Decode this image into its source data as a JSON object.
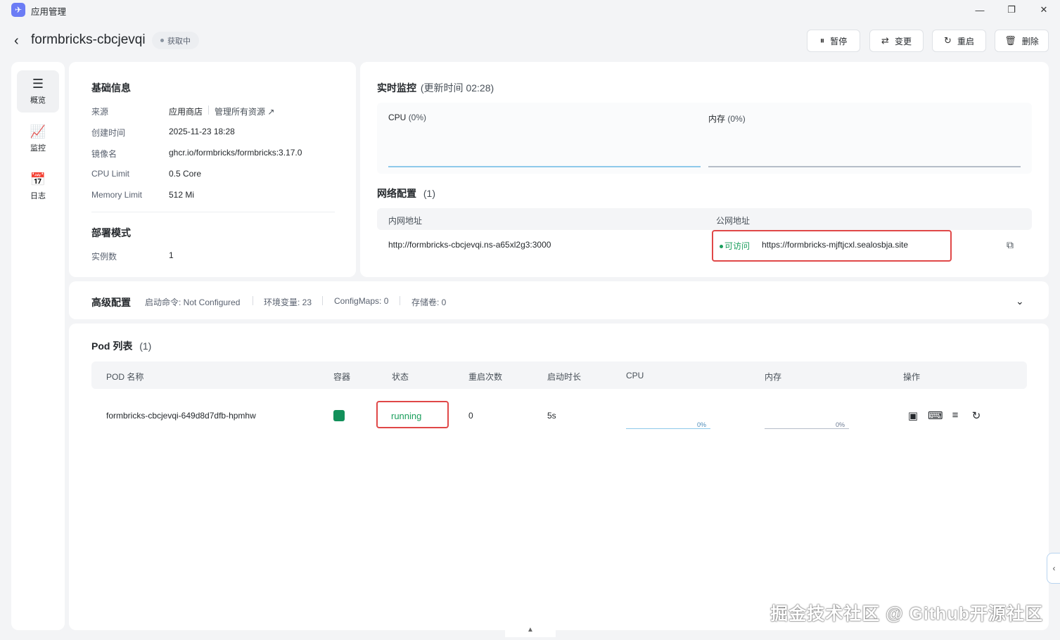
{
  "window": {
    "title": "应用管理",
    "controls": [
      "minimize-icon",
      "restore-icon",
      "close-icon"
    ]
  },
  "header": {
    "app_name": "formbricks-cbcjevqi",
    "status": "获取中",
    "buttons": {
      "pause": "暂停",
      "change": "变更",
      "restart": "重启",
      "delete": "删除"
    }
  },
  "sidebar": {
    "items": [
      {
        "label": "概览",
        "icon": "overview-icon",
        "active": true
      },
      {
        "label": "监控",
        "icon": "chart-icon",
        "active": false
      },
      {
        "label": "日志",
        "icon": "log-icon",
        "active": false
      }
    ]
  },
  "basic_info": {
    "title": "基础信息",
    "source_label": "来源",
    "source_value": "应用商店",
    "source_link": "管理所有资源",
    "created_label": "创建时间",
    "created_value": "2025-11-23 18:28",
    "image_label": "镜像名",
    "image_value": "ghcr.io/formbricks/formbricks:3.17.0",
    "cpu_label": "CPU Limit",
    "cpu_value": "0.5 Core",
    "memory_label": "Memory Limit",
    "memory_value": "512 Mi",
    "deploy_title": "部署模式",
    "instances_label": "实例数",
    "instances_value": "1"
  },
  "monitor": {
    "title": "实时监控",
    "update": "(更新时间  02:28)",
    "cpu_label": "CPU",
    "cpu_value": "(0%)",
    "mem_label": "内存",
    "mem_value": "(0%)"
  },
  "network": {
    "title": "网络配置",
    "count": "(1)",
    "col_internal": "内网地址",
    "col_public": "公网地址",
    "internal_address": "http://formbricks-cbcjevqi.ns-a65xl2g3:3000",
    "public_status": "可访问",
    "public_address": "https://formbricks-mjftjcxl.sealosbja.site"
  },
  "advanced": {
    "title": "高级配置",
    "start_cmd": "启动命令: Not Configured",
    "env": "环境变量: 23",
    "configmaps": "ConfigMaps: 0",
    "storage": "存储卷: 0"
  },
  "pods": {
    "title": "Pod 列表",
    "count": "(1)",
    "columns": [
      "POD 名称",
      "容器",
      "状态",
      "重启次数",
      "启动时长",
      "CPU",
      "内存",
      "操作"
    ],
    "rows": [
      {
        "name": "formbricks-cbcjevqi-649d8d7dfb-hpmhw",
        "status": "running",
        "restarts": "0",
        "uptime": "5s",
        "cpu": "0%",
        "memory": "0%",
        "cpu_fraction": 0,
        "memory_fraction": 0
      }
    ],
    "actions": [
      "calendar-icon",
      "terminal-icon",
      "list-icon",
      "restart-icon"
    ]
  },
  "colors": {
    "running": "#1a9e5c",
    "container_ok": "#12905a",
    "highlight": "#e04848",
    "chart_cpu": "#8ec9ea",
    "chart_mem": "#b5bdc8"
  },
  "watermark": "掘金技术社区 @ Github开源社区"
}
